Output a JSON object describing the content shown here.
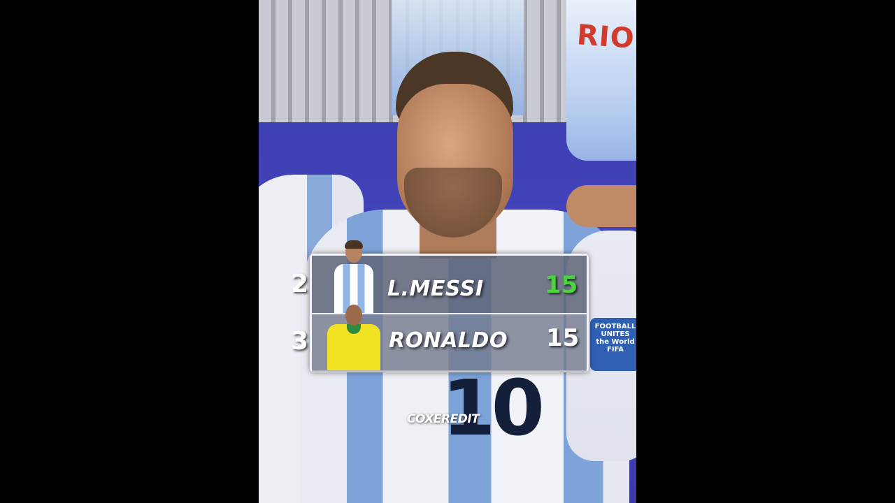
{
  "overlay": {
    "rows": [
      {
        "rank": "2",
        "name": "L.MESSI",
        "score": "15",
        "score_color": "#49d63a"
      },
      {
        "rank": "3",
        "name": "RONALDO",
        "score": "15",
        "score_color": "#ffffff"
      }
    ]
  },
  "background": {
    "banner_text": "RIO",
    "armband_text": "FOOTBALL UNITES the World FIFA",
    "jersey_number": "10"
  },
  "watermark": "COXEREDIT",
  "colors": {
    "frame": "#000000",
    "board_border": "#f4f4f6",
    "highlight_score": "#49d63a",
    "messi_kit": "#7ea3d8",
    "ronaldo_kit": "#f2e224"
  }
}
